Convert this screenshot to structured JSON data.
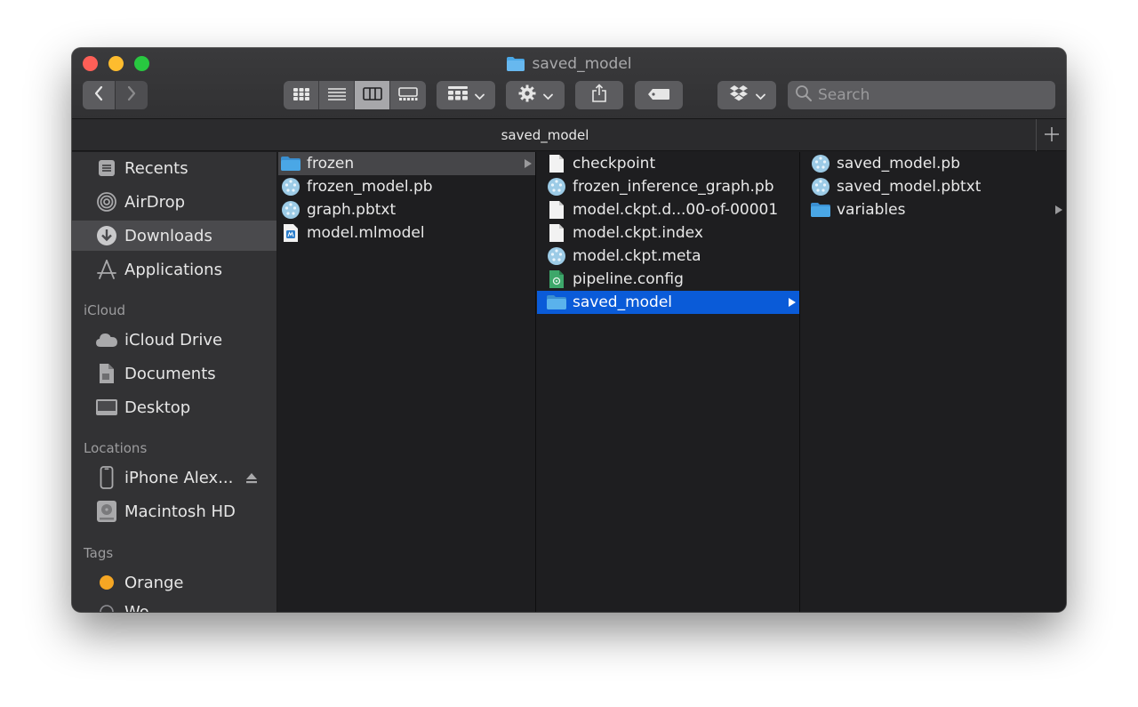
{
  "window": {
    "title": "saved_model",
    "tab_title": "saved_model"
  },
  "toolbar": {
    "search_placeholder": "Search"
  },
  "sidebar": {
    "favorites": [
      {
        "label": "Recents",
        "icon": "clock-icon"
      },
      {
        "label": "AirDrop",
        "icon": "airdrop-icon"
      },
      {
        "label": "Downloads",
        "icon": "downloads-icon",
        "selected": true
      },
      {
        "label": "Applications",
        "icon": "applications-icon"
      }
    ],
    "icloud_heading": "iCloud",
    "icloud": [
      {
        "label": "iCloud Drive",
        "icon": "cloud-icon"
      },
      {
        "label": "Documents",
        "icon": "documents-icon"
      },
      {
        "label": "Desktop",
        "icon": "desktop-icon"
      }
    ],
    "locations_heading": "Locations",
    "locations": [
      {
        "label": "iPhone Alex...",
        "icon": "iphone-icon"
      },
      {
        "label": "Macintosh HD",
        "icon": "harddrive-icon"
      }
    ],
    "tags_heading": "Tags",
    "tags": [
      {
        "label": "Orange",
        "color": "#f5a623"
      },
      {
        "label": "Wo...",
        "color": "#8e8e93"
      }
    ]
  },
  "columns": [
    {
      "items": [
        {
          "name": "frozen",
          "type": "folder",
          "selected": "gray"
        },
        {
          "name": "frozen_model.pb",
          "type": "tf"
        },
        {
          "name": "graph.pbtxt",
          "type": "tf"
        },
        {
          "name": "model.mlmodel",
          "type": "mlmodel"
        }
      ]
    },
    {
      "items": [
        {
          "name": "checkpoint",
          "type": "file"
        },
        {
          "name": "frozen_inference_graph.pb",
          "type": "tf"
        },
        {
          "name": "model.ckpt.d...00-of-00001",
          "type": "file"
        },
        {
          "name": "model.ckpt.index",
          "type": "file"
        },
        {
          "name": "model.ckpt.meta",
          "type": "tf"
        },
        {
          "name": "pipeline.config",
          "type": "config"
        },
        {
          "name": "saved_model",
          "type": "folder",
          "selected": "blue"
        }
      ]
    },
    {
      "items": [
        {
          "name": "saved_model.pb",
          "type": "tf"
        },
        {
          "name": "saved_model.pbtxt",
          "type": "tf"
        },
        {
          "name": "variables",
          "type": "folder"
        }
      ]
    }
  ],
  "colors": {
    "selection_blue": "#0a5bd8",
    "folder_blue": "#4aa7e6",
    "close": "#fe5f57",
    "minimize": "#febc2e",
    "zoom": "#28c840"
  }
}
